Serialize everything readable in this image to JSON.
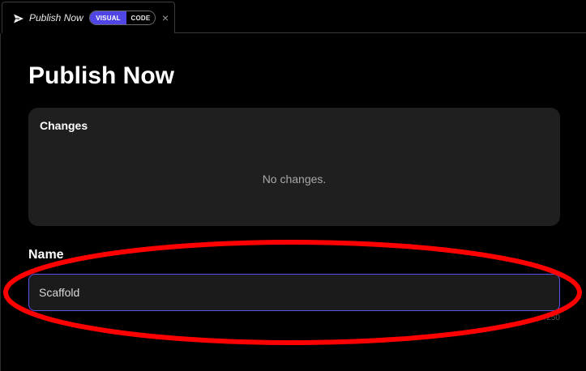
{
  "tab": {
    "title": "Publish Now",
    "icon": "send-icon",
    "mode_visual_label": "VISUAL",
    "mode_code_label": "CODE",
    "active_mode": "VISUAL",
    "close_glyph": "×"
  },
  "page": {
    "title": "Publish Now"
  },
  "changes": {
    "heading": "Changes",
    "empty_text": "No changes."
  },
  "name_field": {
    "label": "Name",
    "value": "Scaffold",
    "char_count": "/250"
  },
  "colors": {
    "background": "#000000",
    "card": "#1f1f1f",
    "accent": "#5046e5",
    "annotation": "#ff0000"
  }
}
